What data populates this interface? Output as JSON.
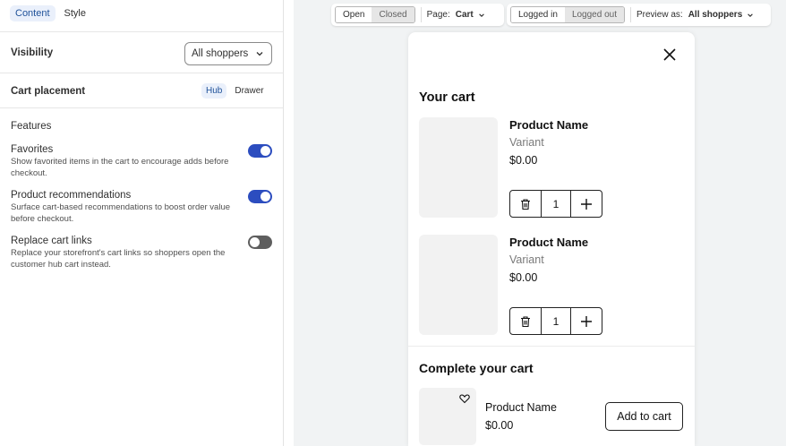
{
  "panel": {
    "tabs": [
      {
        "label": "Content",
        "active": true
      },
      {
        "label": "Style",
        "active": false
      }
    ],
    "visibility": {
      "label": "Visibility",
      "value": "All shoppers"
    },
    "cart_placement": {
      "label": "Cart placement",
      "options": [
        "Hub",
        "Drawer"
      ],
      "selected": "Hub"
    },
    "features": {
      "heading": "Features",
      "items": [
        {
          "title": "Favorites",
          "description": "Show favorited items in the cart to encourage adds before checkout.",
          "enabled": true
        },
        {
          "title": "Product recommendations",
          "description": "Surface cart-based recommendations to boost order value before checkout.",
          "enabled": true
        },
        {
          "title": "Replace cart links",
          "description": "Replace your storefront's cart links so shoppers open the customer hub cart instead.",
          "enabled": false
        }
      ]
    },
    "colors": {
      "accent": "#2c4dbf",
      "toggle_off": "#5e5e5e",
      "tab_active_bg": "#eaf0fb"
    }
  },
  "toolbar": {
    "state": {
      "options": [
        "Open",
        "Closed"
      ],
      "selected": "Open"
    },
    "page": {
      "label": "Page:",
      "value": "Cart"
    },
    "login": {
      "options": [
        "Logged in",
        "Logged out"
      ],
      "selected": "Logged in"
    },
    "preview": {
      "label": "Preview as:",
      "value": "All shoppers"
    }
  },
  "cart": {
    "title": "Your cart",
    "items": [
      {
        "name": "Product Name",
        "variant": "Variant",
        "price": "$0.00",
        "quantity": "1"
      },
      {
        "name": "Product Name",
        "variant": "Variant",
        "price": "$0.00",
        "quantity": "1"
      }
    ],
    "recommendations": {
      "title": "Complete your cart",
      "items": [
        {
          "name": "Product Name",
          "price": "$0.00",
          "button": "Add to cart"
        }
      ]
    }
  }
}
